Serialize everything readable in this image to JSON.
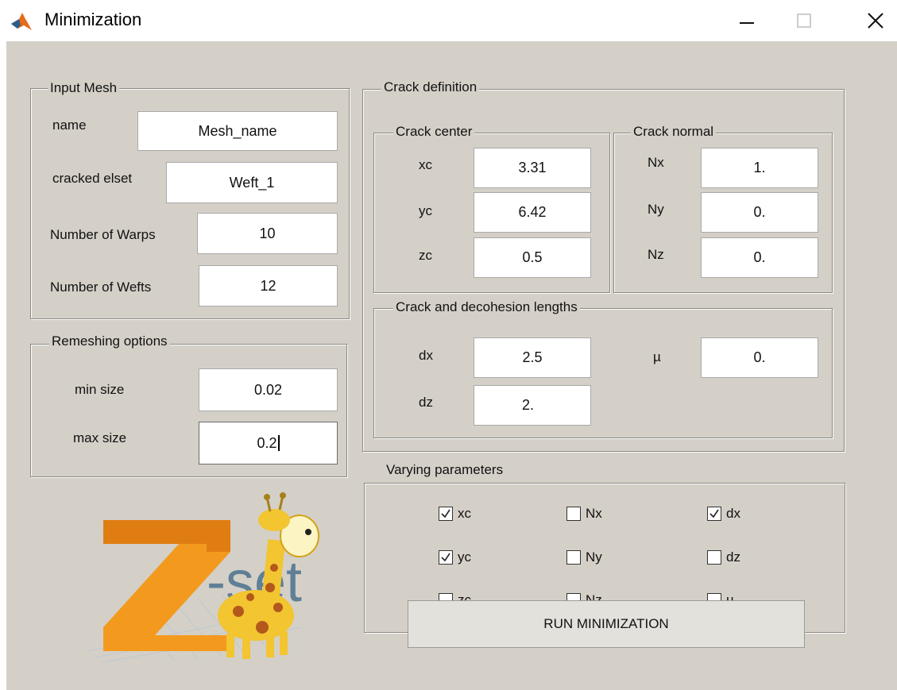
{
  "window": {
    "title": "Minimization",
    "minimize_icon": "minimize-icon",
    "maximize_icon": "maximize-icon",
    "close_icon": "close-icon"
  },
  "input_mesh": {
    "title": "Input Mesh",
    "name_label": "name",
    "name_value": "Mesh_name",
    "elset_label": "cracked elset",
    "elset_value": "Weft_1",
    "warps_label": "Number of Warps",
    "warps_value": "10",
    "wefts_label": "Number of Wefts",
    "wefts_value": "12"
  },
  "remeshing": {
    "title": "Remeshing options",
    "min_label": "min size",
    "min_value": "0.02",
    "max_label": "max size",
    "max_value": "0.2"
  },
  "crack_definition": {
    "title": "Crack definition",
    "center": {
      "title": "Crack center",
      "xc_label": "xc",
      "xc_value": "3.31",
      "yc_label": "yc",
      "yc_value": "6.42",
      "zc_label": "zc",
      "zc_value": "0.5"
    },
    "normal": {
      "title": "Crack normal",
      "nx_label": "Nx",
      "nx_value": "1.",
      "ny_label": "Ny",
      "ny_value": "0.",
      "nz_label": "Nz",
      "nz_value": "0."
    },
    "lengths": {
      "title": "Crack and decohesion lengths",
      "dx_label": "dx",
      "dx_value": "2.5",
      "dz_label": "dz",
      "dz_value": "2.",
      "mu_label": "µ",
      "mu_value": "0."
    }
  },
  "varying": {
    "title": "Varying parameters",
    "items": [
      {
        "label": "xc",
        "checked": true
      },
      {
        "label": "Nx",
        "checked": false
      },
      {
        "label": "dx",
        "checked": true
      },
      {
        "label": "yc",
        "checked": true
      },
      {
        "label": "Ny",
        "checked": false
      },
      {
        "label": "dz",
        "checked": false
      },
      {
        "label": "zc",
        "checked": false
      },
      {
        "label": "Nz",
        "checked": false
      },
      {
        "label": "µ",
        "checked": false
      }
    ]
  },
  "logo": {
    "text": "-set",
    "icon": "zset-giraffe-logo"
  },
  "run_button": {
    "label": "RUN MINIMIZATION"
  },
  "colors": {
    "client_bg": "#d4d0c8",
    "logo_orange": "#f39a1e",
    "logo_text": "#5f7f96"
  }
}
